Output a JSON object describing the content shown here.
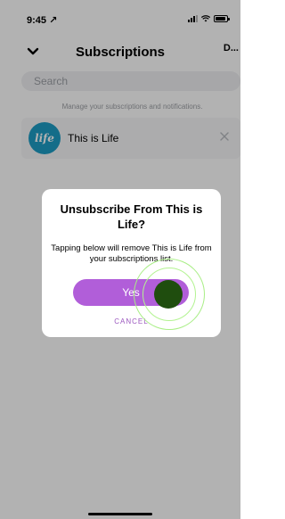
{
  "status_bar": {
    "time": "9:45 ↗"
  },
  "header": {
    "title": "Subscriptions",
    "done_label": "D..."
  },
  "search": {
    "placeholder": "Search"
  },
  "manage_text": "Manage your subscriptions and notifications.",
  "subscriptions": [
    {
      "logo_text": "life",
      "name": "This is Life"
    }
  ],
  "dialog": {
    "title": "Unsubscribe From This is Life?",
    "message": "Tapping below will remove This is Life from your subscriptions list.",
    "yes_label": "Yes",
    "cancel_label": "CANCEL"
  },
  "colors": {
    "accent": "#b15ed9",
    "logo_bg": "#1e9cc4",
    "tap_dot": "#1f4d0e"
  },
  "icons": {
    "back": "chevron-down-icon",
    "close": "close-icon",
    "signal": "signal-icon",
    "wifi": "wifi-icon",
    "battery": "battery-icon"
  }
}
